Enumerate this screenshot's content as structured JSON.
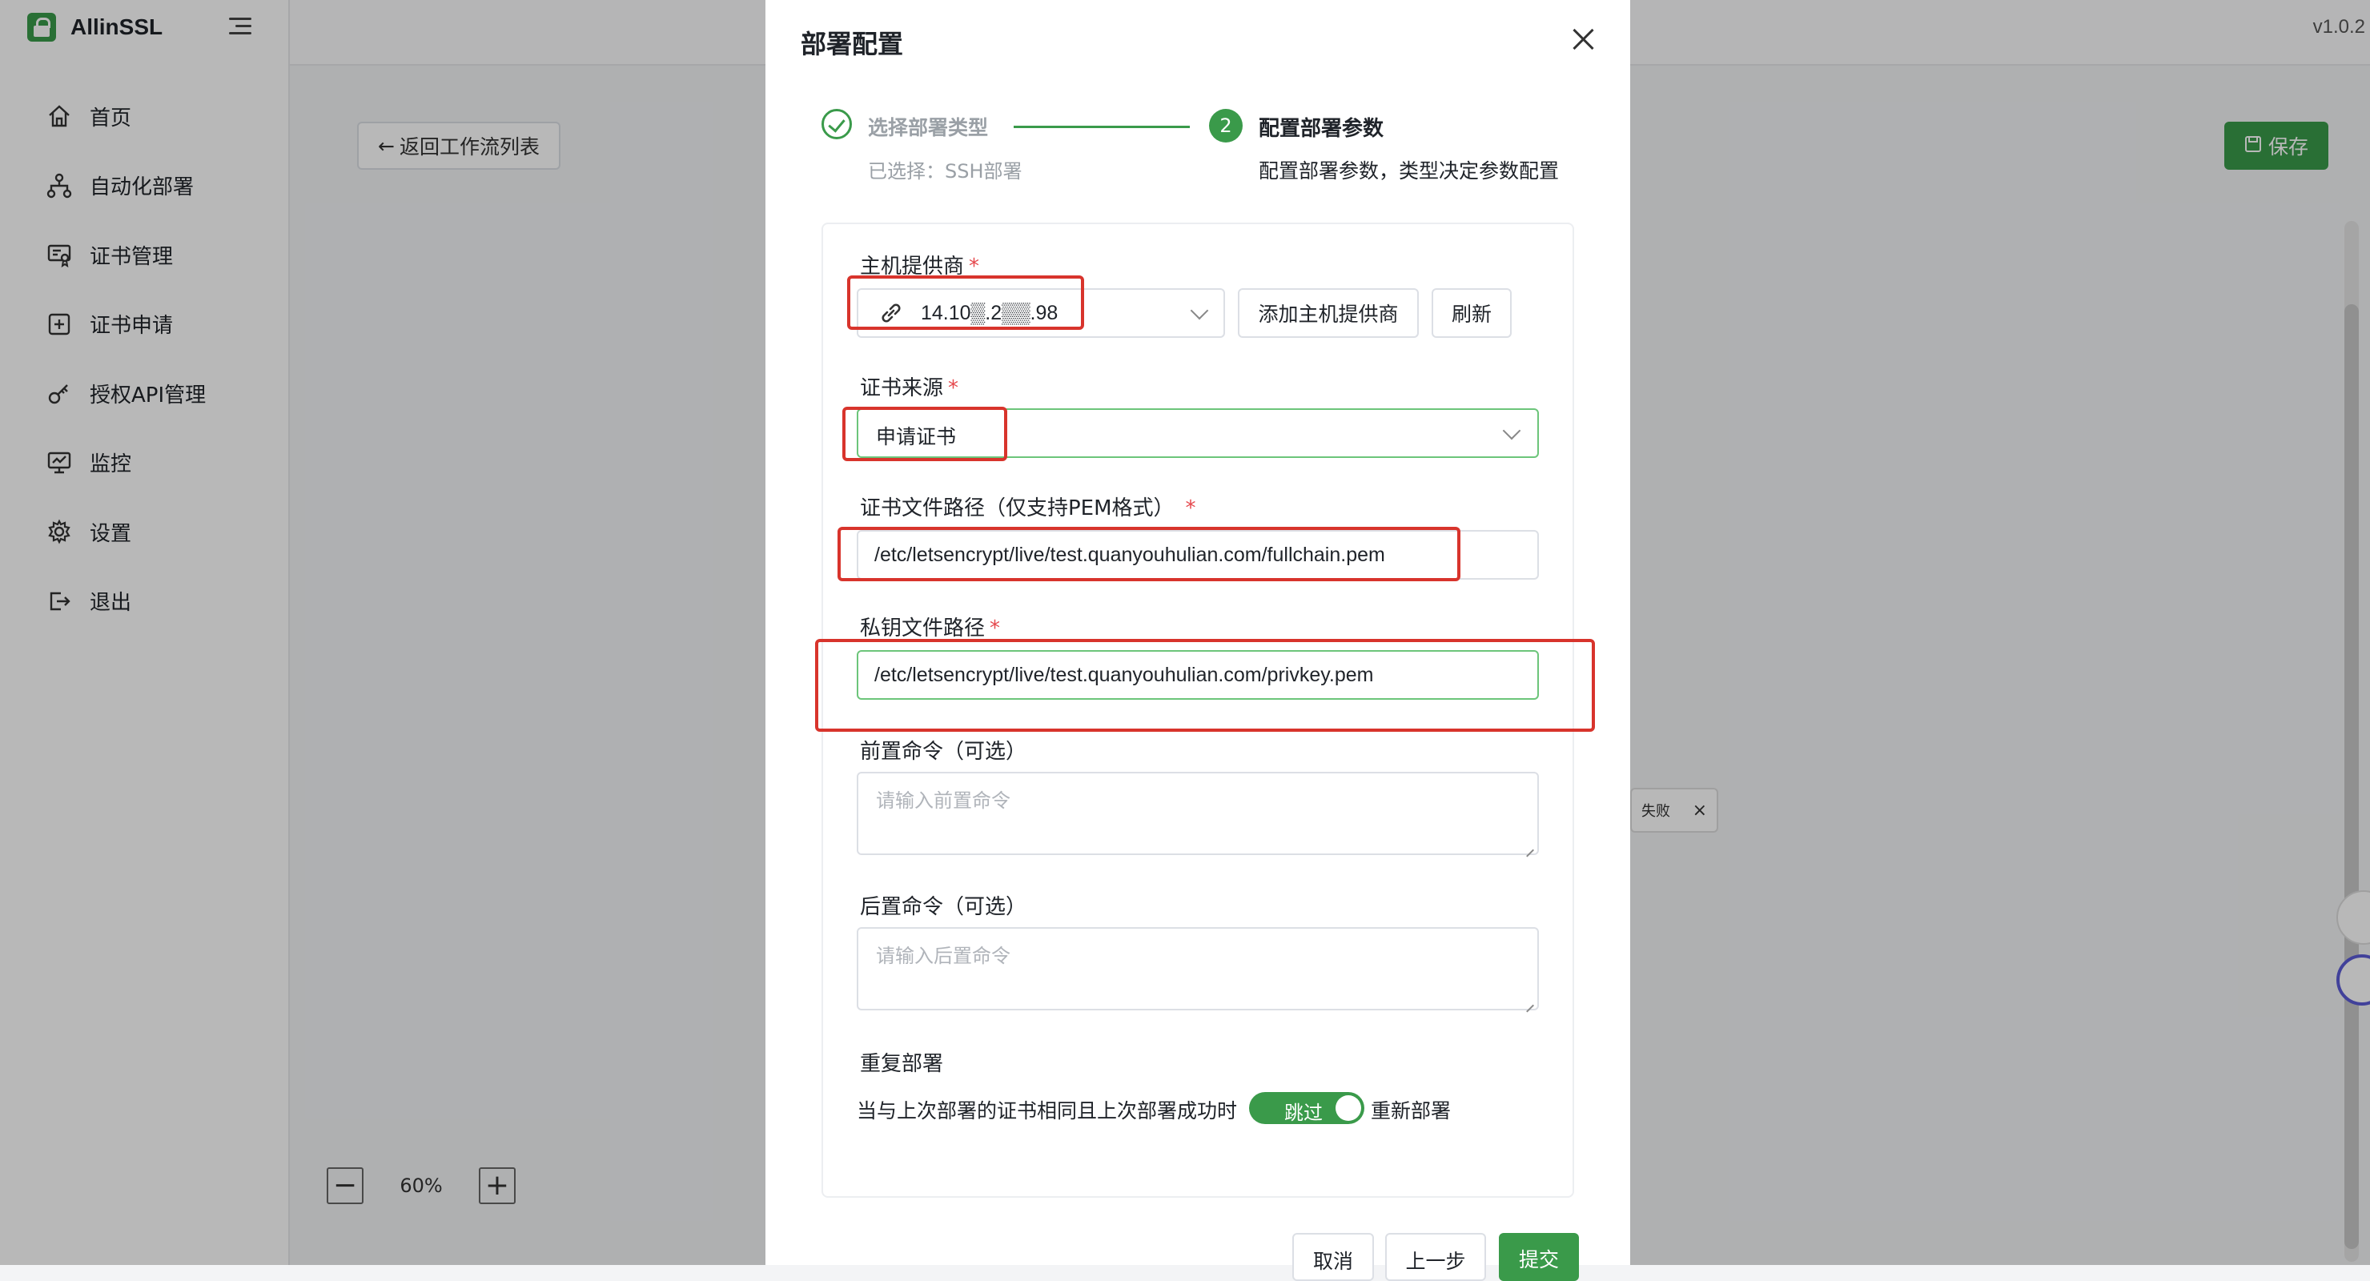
{
  "app": {
    "brand": "AllinSSL",
    "version": "v1.0.2"
  },
  "sidebar": {
    "items": [
      {
        "label": "首页",
        "icon": "home-icon"
      },
      {
        "label": "自动化部署",
        "icon": "workflow-icon"
      },
      {
        "label": "证书管理",
        "icon": "certificate-icon"
      },
      {
        "label": "证书申请",
        "icon": "plus-square-icon"
      },
      {
        "label": "授权API管理",
        "icon": "key-icon"
      },
      {
        "label": "监控",
        "icon": "monitor-icon"
      },
      {
        "label": "设置",
        "icon": "gear-icon"
      },
      {
        "label": "退出",
        "icon": "logout-icon"
      }
    ]
  },
  "toolbar": {
    "back_label": "返回工作流列表",
    "save_label": "保存"
  },
  "zoom": {
    "minus": "−",
    "value": "60%",
    "plus": "+"
  },
  "canvas": {
    "node_text": "失败"
  },
  "modal": {
    "title": "部署配置",
    "steps": [
      {
        "number": "",
        "title": "选择部署类型",
        "desc": "已选择：SSH部署",
        "status": "done"
      },
      {
        "number": "2",
        "title": "配置部署参数",
        "desc": "配置部署参数，类型决定参数配置",
        "status": "active"
      }
    ],
    "fields": {
      "host_provider": {
        "label": "主机提供商",
        "value": "14.10▒.2▒▒.98",
        "add_button": "添加主机提供商",
        "refresh_button": "刷新"
      },
      "cert_source": {
        "label": "证书来源",
        "value": "申请证书"
      },
      "cert_path": {
        "label": "证书文件路径（仅支持PEM格式）",
        "value": "/etc/letsencrypt/live/test.quanyouhulian.com/fullchain.pem"
      },
      "key_path": {
        "label": "私钥文件路径",
        "value": "/etc/letsencrypt/live/test.quanyouhulian.com/privkey.pem"
      },
      "pre_command": {
        "label": "前置命令（可选）",
        "placeholder": "请输入前置命令"
      },
      "post_command": {
        "label": "后置命令（可选）",
        "placeholder": "请输入后置命令"
      },
      "repeat": {
        "label": "重复部署",
        "condition": "当与上次部署的证书相同且上次部署成功时",
        "toggle_label": "跳过",
        "toggle_on": true,
        "after_text": "重新部署"
      }
    },
    "footer": {
      "cancel": "取消",
      "prev": "上一步",
      "submit": "提交"
    }
  },
  "colors": {
    "accent": "#3a9a4a",
    "highlight": "#d8342c",
    "required": "#e5484d"
  }
}
